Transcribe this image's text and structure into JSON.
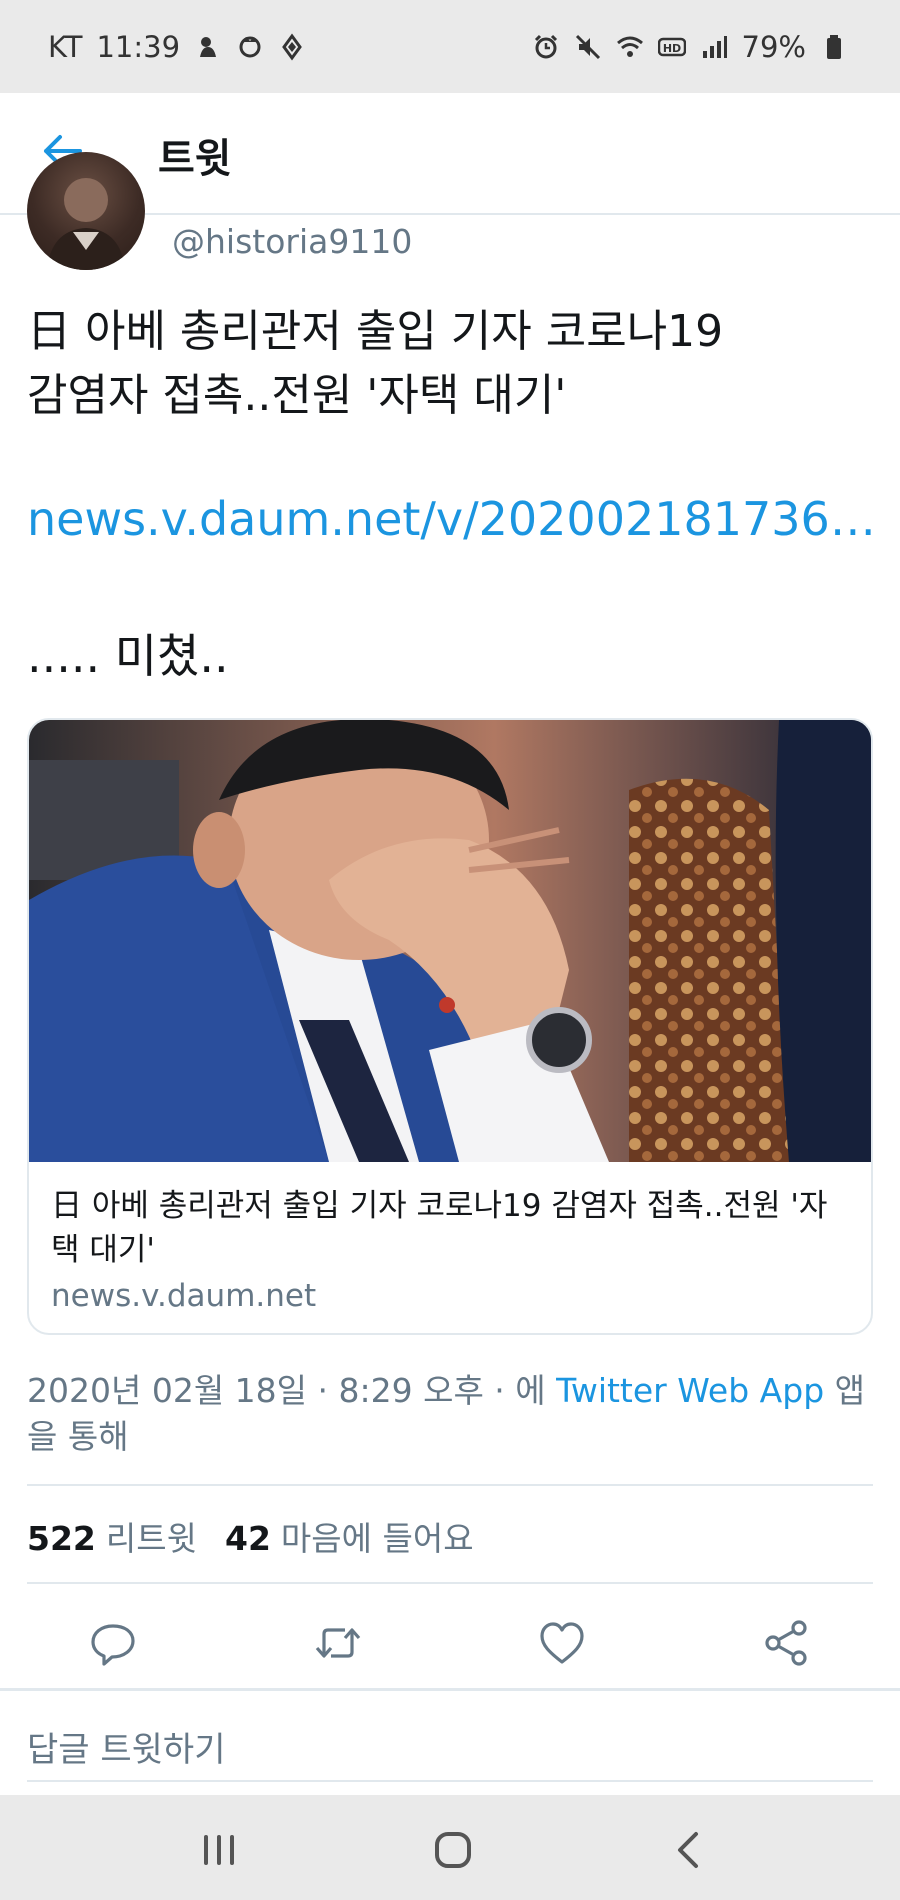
{
  "status_bar": {
    "carrier": "KT",
    "time": "11:39",
    "battery": "79%",
    "left_icons": [
      "bixby-icon",
      "character-icon",
      "game-icon"
    ],
    "right_icons": [
      "alarm-icon",
      "mute-icon",
      "wifi-icon",
      "hd-icon",
      "signal-icon",
      "battery-icon"
    ]
  },
  "header": {
    "title": "트윗"
  },
  "author": {
    "handle": "@historia9110"
  },
  "tweet": {
    "text_line1": "日 아베 총리관저 출입 기자 코로나19",
    "text_line2": "감염자 접촉..전원 '자택 대기'",
    "link": "news.v.daum.net/v/202002181736…",
    "note": "..... 미쳤.."
  },
  "card": {
    "title": "日 아베 총리관저 출입 기자 코로나19 감염자 접촉..전원 '자택 대기'",
    "domain": "news.v.daum.net"
  },
  "meta": {
    "datetime": "2020년 02월 18일 · 8:29 오후 · 에 ",
    "app": "Twitter Web App",
    "suffix": " 앱을 통해"
  },
  "stats": {
    "retweet_count": "522",
    "retweet_label": "리트윗",
    "like_count": "42",
    "like_label": "마음에 들어요"
  },
  "actions": [
    "reply-icon",
    "retweet-icon",
    "like-icon",
    "share-icon"
  ],
  "reply": {
    "placeholder": "답글 트윗하기"
  },
  "nav": [
    "recent-apps-icon",
    "home-icon",
    "back-icon"
  ],
  "colors": {
    "accent": "#1b95e0",
    "secondary_text": "#657786",
    "divider": "#e1e8ed",
    "system_bar": "#eaeaea"
  }
}
